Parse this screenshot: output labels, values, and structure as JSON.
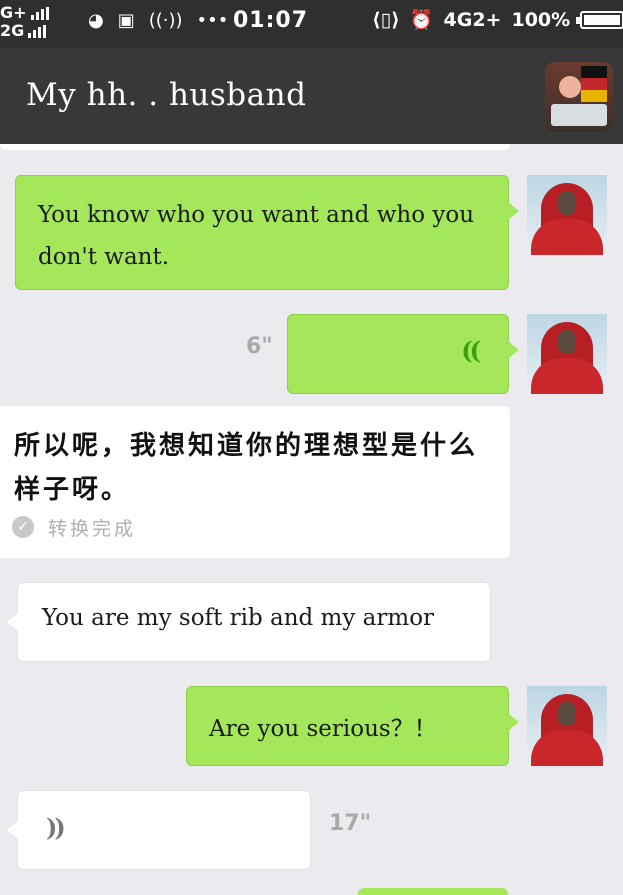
{
  "status_bar": {
    "network_top": "G+",
    "network_bottom": "2G",
    "time": "01:07",
    "network_type": "4G2+",
    "battery": "100%"
  },
  "header": {
    "title": "My  hh. . husband"
  },
  "messages": [
    {
      "id": "m1",
      "side": "right",
      "type": "text",
      "text": "You know who you  want and who you  don't want."
    },
    {
      "id": "m2",
      "side": "right",
      "type": "voice",
      "duration": "6\""
    },
    {
      "id": "m3",
      "side": "left",
      "type": "transcription",
      "text": "所以呢，我想知道你的理想型是什么样子呀。",
      "status": "转换完成"
    },
    {
      "id": "m4",
      "side": "left",
      "type": "text",
      "text": "You are my soft rib and my armor"
    },
    {
      "id": "m5",
      "side": "right",
      "type": "text",
      "text": "Are  you  serious？！"
    },
    {
      "id": "m6",
      "side": "left",
      "type": "voice",
      "duration": "17\""
    }
  ],
  "colors": {
    "sent_bubble": "#a4e75a",
    "received_bubble": "#ffffff",
    "background": "#ebeaee",
    "header": "#383838"
  }
}
